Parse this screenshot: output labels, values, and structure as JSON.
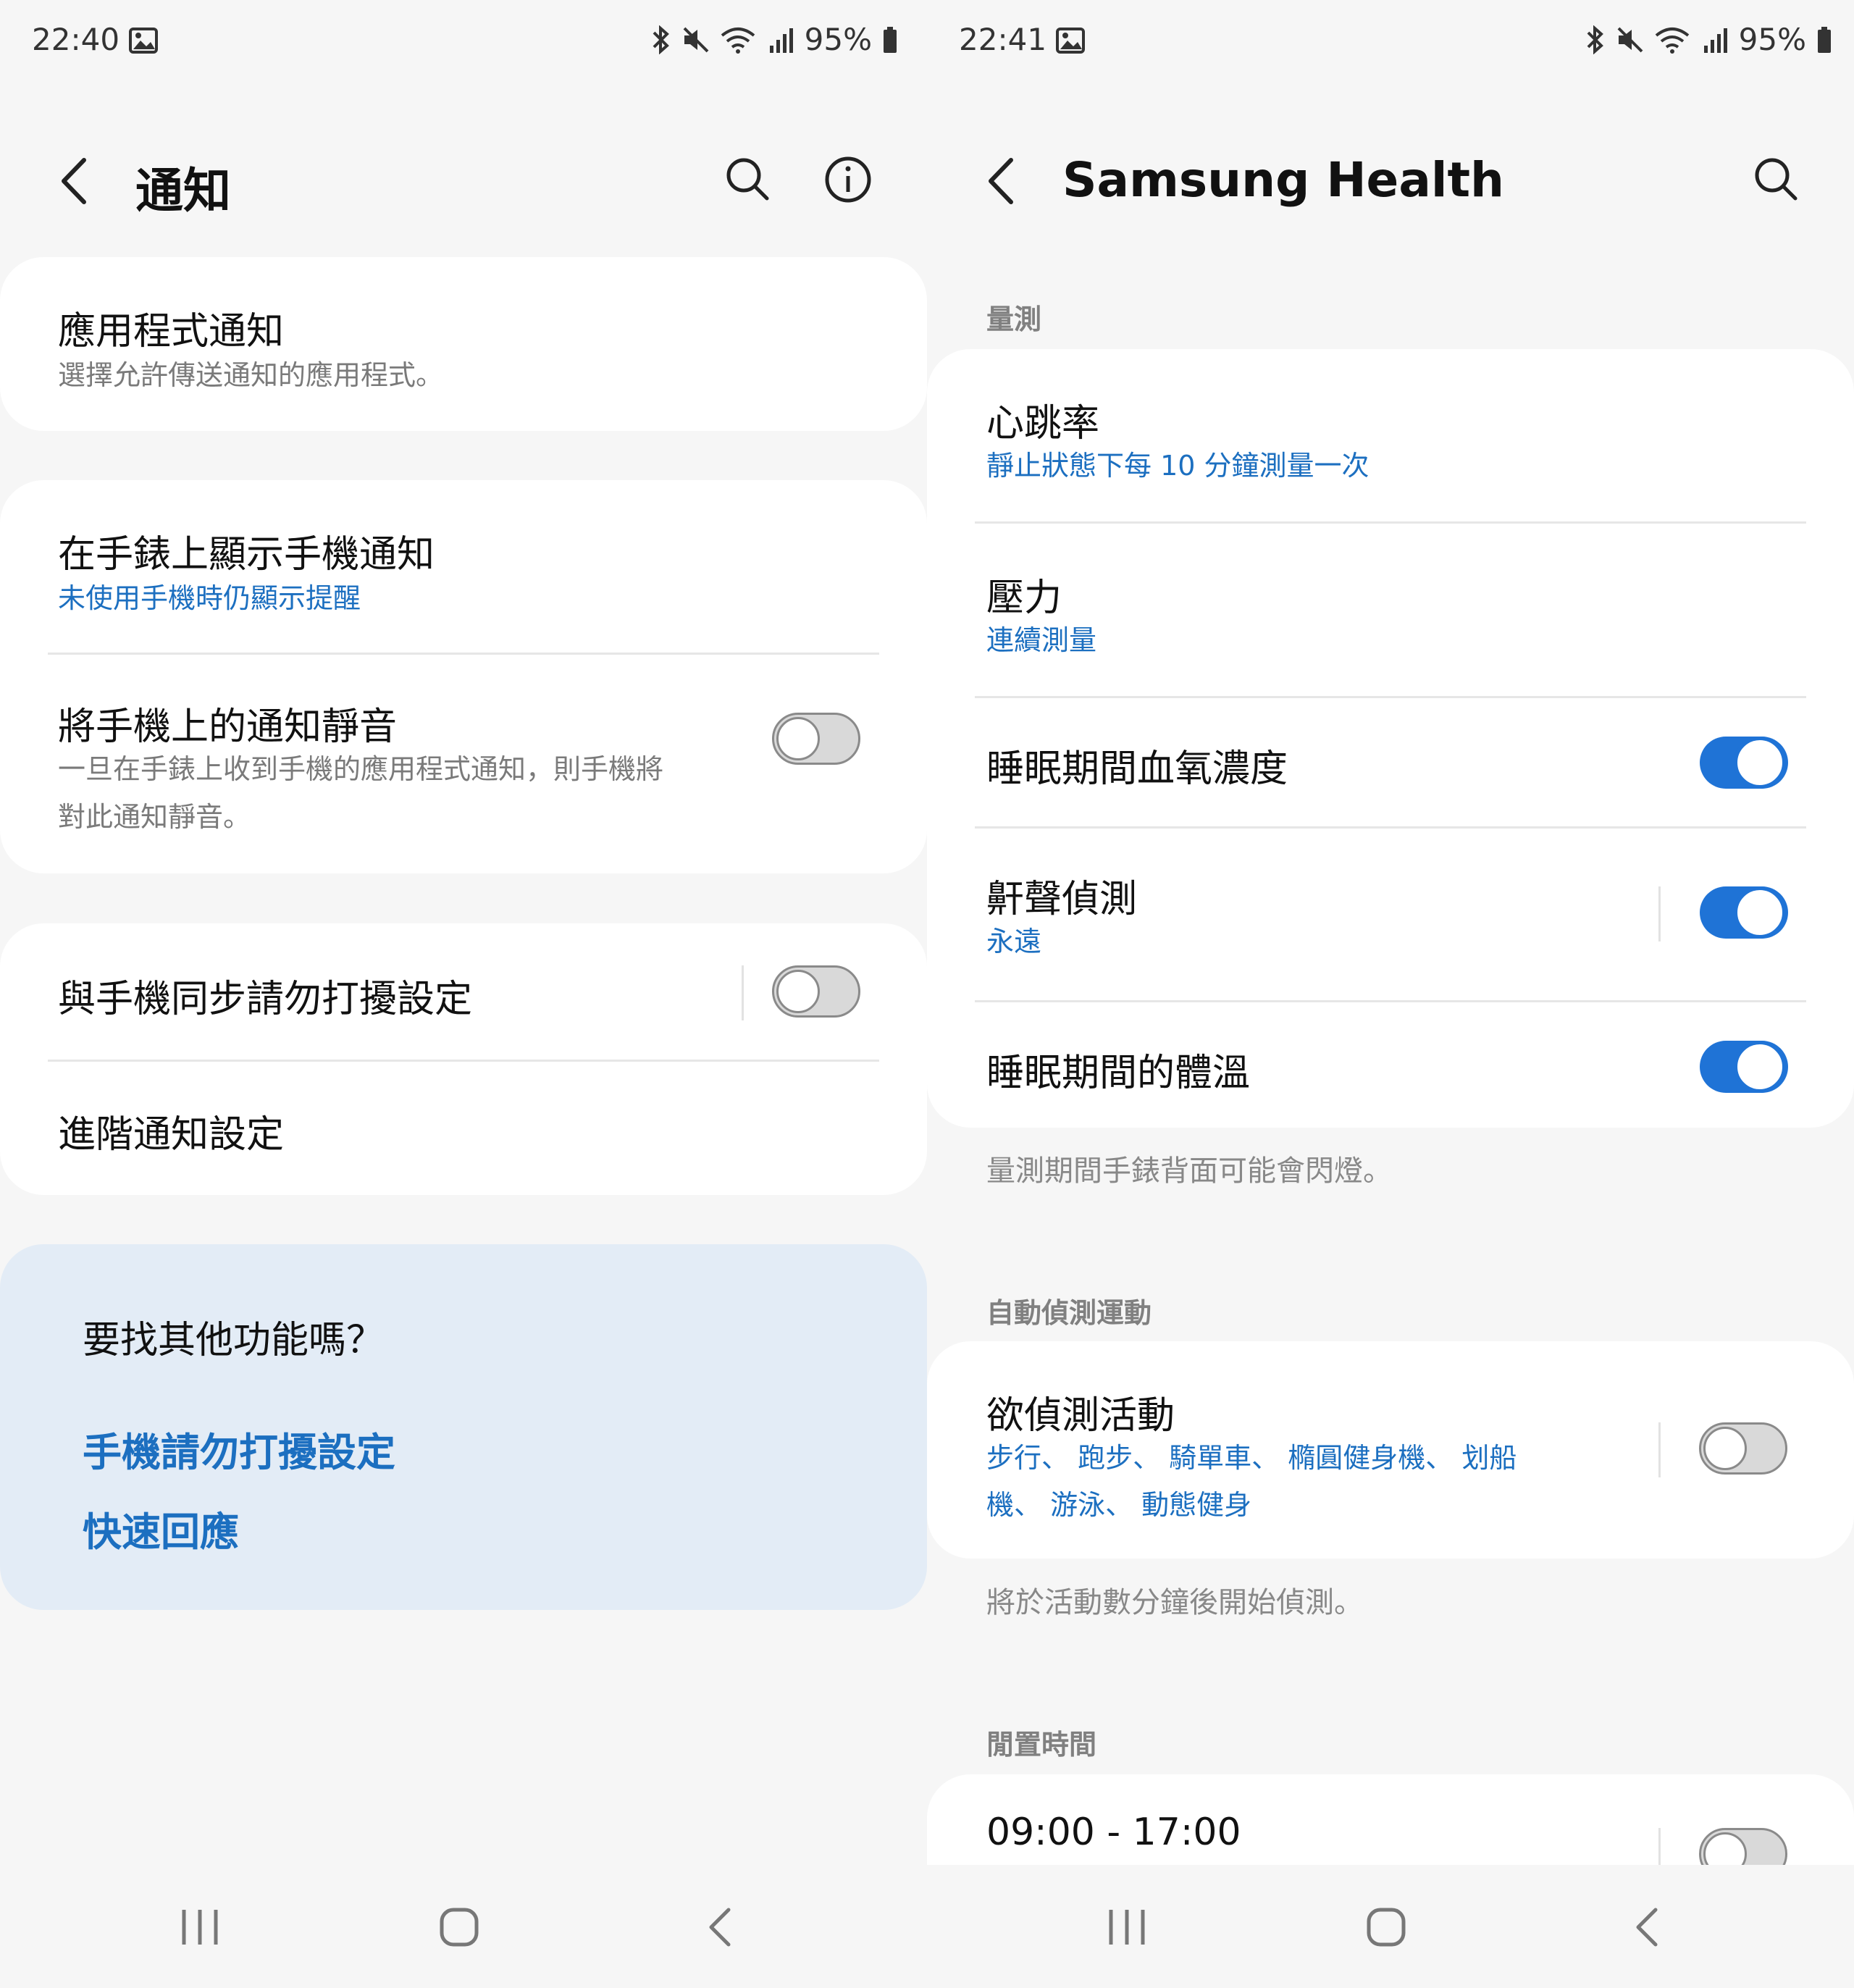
{
  "left": {
    "status": {
      "time": "22:40",
      "battery": "95%"
    },
    "header": {
      "title": "通知"
    },
    "items": {
      "app_notifications": {
        "title": "應用程式通知",
        "subtitle": "選擇允許傳送通知的應用程式。"
      },
      "show_phone_notifs": {
        "title": "在手錶上顯示手機通知",
        "subtitle": "未使用手機時仍顯示提醒"
      },
      "mute_on_phone": {
        "title": "將手機上的通知靜音",
        "subtitle_line1": "一旦在手錶上收到手機的應用程式通知，則手機將",
        "subtitle_line2": "對此通知靜音。",
        "enabled": false
      },
      "sync_dnd": {
        "title": "與手機同步請勿打擾設定",
        "enabled": false
      },
      "advanced": {
        "title": "進階通知設定"
      }
    },
    "suggestions": {
      "heading": "要找其他功能嗎？",
      "links": [
        "手機請勿打擾設定",
        "快速回應"
      ]
    }
  },
  "right": {
    "status": {
      "time": "22:41",
      "battery": "95%"
    },
    "header": {
      "title": "Samsung Health"
    },
    "sections": {
      "measurement": {
        "label": "量測",
        "heart_rate": {
          "title": "心跳率",
          "subtitle": "靜止狀態下每 10 分鐘測量一次"
        },
        "stress": {
          "title": "壓力",
          "subtitle": "連續測量"
        },
        "blood_oxygen": {
          "title": "睡眠期間血氧濃度",
          "enabled": true
        },
        "snore": {
          "title": "鼾聲偵測",
          "subtitle": "永遠",
          "enabled": true
        },
        "skin_temp": {
          "title": "睡眠期間的體溫",
          "enabled": true
        },
        "note": "量測期間手錶背面可能會閃燈。"
      },
      "auto_detect": {
        "label": "自動偵測運動",
        "activities": {
          "title": "欲偵測活動",
          "subtitle_line1": "步行、 跑步、 騎單車、 橢圓健身機、 划船",
          "subtitle_line2": "機、 游泳、 動態健身",
          "enabled": false
        },
        "note": "將於活動數分鐘後開始偵測。"
      },
      "idle_time": {
        "label": "閒置時間",
        "range": {
          "title": "09:00 - 17:00",
          "enabled": false
        }
      }
    }
  }
}
